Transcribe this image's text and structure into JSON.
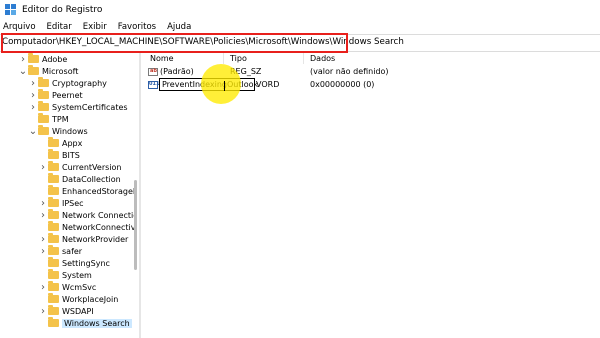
{
  "window": {
    "title": "Editor do Registro"
  },
  "menu": [
    "Arquivo",
    "Editar",
    "Exibir",
    "Favoritos",
    "Ajuda"
  ],
  "address": "Computador\\HKEY_LOCAL_MACHINE\\SOFTWARE\\Policies\\Microsoft\\Windows\\Windows Search",
  "tree": [
    {
      "label": "Adobe",
      "depth": 1,
      "chevron": "right"
    },
    {
      "label": "Microsoft",
      "depth": 1,
      "chevron": "down"
    },
    {
      "label": "Cryptography",
      "depth": 2,
      "chevron": "right"
    },
    {
      "label": "Peernet",
      "depth": 2,
      "chevron": "right"
    },
    {
      "label": "SystemCertificates",
      "depth": 2,
      "chevron": "right"
    },
    {
      "label": "TPM",
      "depth": 2,
      "chevron": "none"
    },
    {
      "label": "Windows",
      "depth": 2,
      "chevron": "down"
    },
    {
      "label": "Appx",
      "depth": 3,
      "chevron": "none"
    },
    {
      "label": "BITS",
      "depth": 3,
      "chevron": "none"
    },
    {
      "label": "CurrentVersion",
      "depth": 3,
      "chevron": "right"
    },
    {
      "label": "DataCollection",
      "depth": 3,
      "chevron": "none"
    },
    {
      "label": "EnhancedStorageD",
      "depth": 3,
      "chevron": "none"
    },
    {
      "label": "IPSec",
      "depth": 3,
      "chevron": "right"
    },
    {
      "label": "Network Connectic",
      "depth": 3,
      "chevron": "right"
    },
    {
      "label": "NetworkConnectivi",
      "depth": 3,
      "chevron": "none"
    },
    {
      "label": "NetworkProvider",
      "depth": 3,
      "chevron": "right"
    },
    {
      "label": "safer",
      "depth": 3,
      "chevron": "right"
    },
    {
      "label": "SettingSync",
      "depth": 3,
      "chevron": "none"
    },
    {
      "label": "System",
      "depth": 3,
      "chevron": "none"
    },
    {
      "label": "WcmSvc",
      "depth": 3,
      "chevron": "right"
    },
    {
      "label": "WorkplaceJoin",
      "depth": 3,
      "chevron": "none"
    },
    {
      "label": "WSDAPI",
      "depth": 3,
      "chevron": "right"
    },
    {
      "label": "Windows Search",
      "depth": 3,
      "chevron": "none",
      "selected": true
    }
  ],
  "columns": {
    "name": "Nome",
    "type": "Tipo",
    "data": "Dados"
  },
  "values": [
    {
      "name": "(Padrão)",
      "type": "REG_SZ",
      "data": "(valor não definido)",
      "icon": "ab"
    },
    {
      "name": "PreventIndexingOutlook",
      "type": "VORD",
      "data": "0x00000000 (0)",
      "icon": "011"
    }
  ],
  "colors": {
    "highlight_box": "#e8201c",
    "cursor_highlight": "#ffeb00",
    "folder": "#f4c34a"
  }
}
